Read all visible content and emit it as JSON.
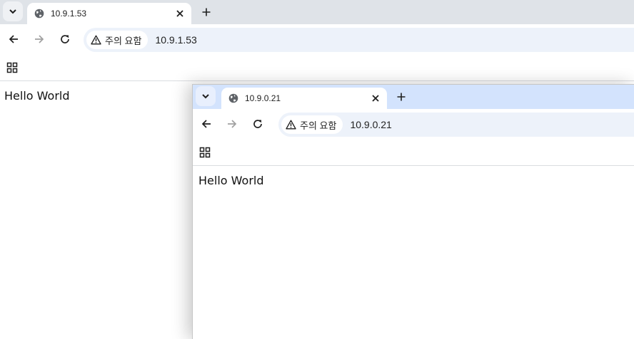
{
  "windows": {
    "back": {
      "tab_title": "10.9.1.53",
      "security_label": "주의 요함",
      "url": "10.9.1.53",
      "page_text": "Hello World"
    },
    "front": {
      "tab_title": "10.9.0.21",
      "security_label": "주의 요함",
      "url": "10.9.0.21",
      "page_text": "Hello World"
    }
  },
  "icons": {
    "tab_search": "chevron-down-icon",
    "favicon": "globe-icon",
    "close": "close-icon",
    "new_tab": "plus-icon",
    "back": "arrow-left-icon",
    "forward": "arrow-right-icon",
    "reload": "reload-icon",
    "security": "warning-triangle-icon",
    "apps": "apps-grid-icon"
  },
  "colors": {
    "back_tabstrip": "#dfe3e8",
    "front_tabstrip": "#d3e3fd",
    "omnibox": "#edf2fa"
  }
}
